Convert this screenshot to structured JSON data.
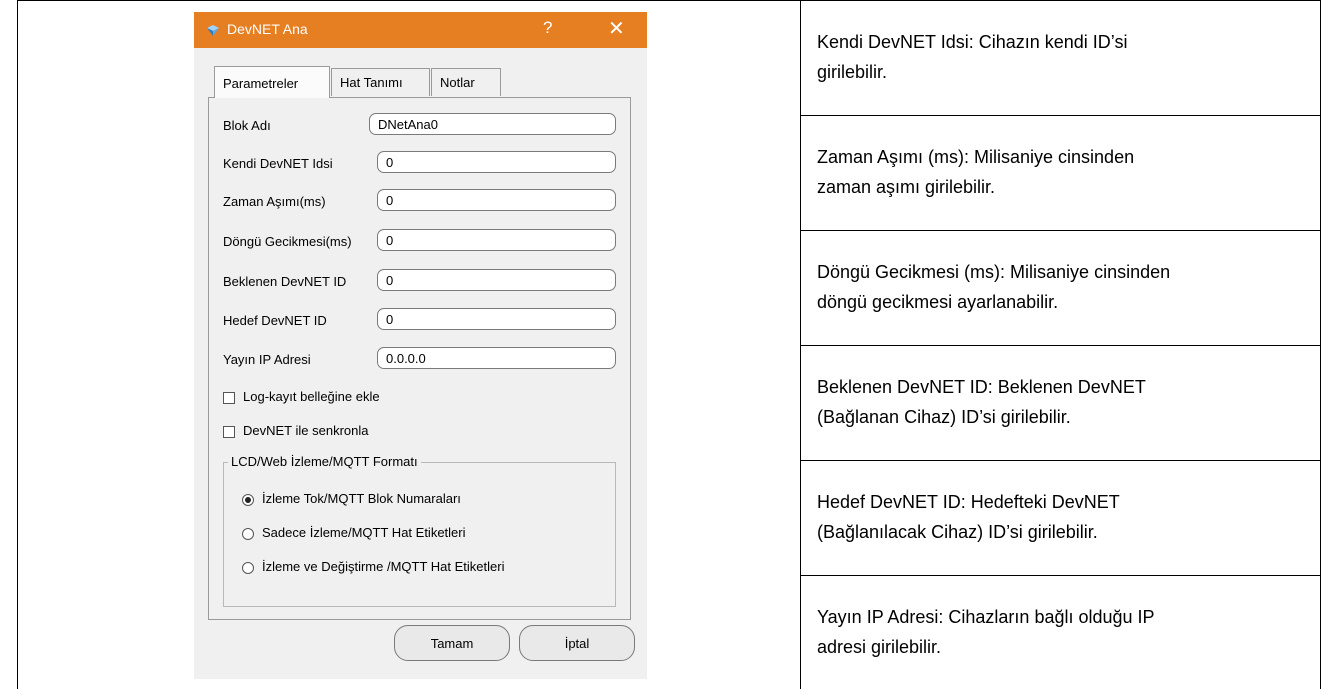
{
  "dialog": {
    "title": "DevNET Ana",
    "help_label": "?",
    "close_label": "✕",
    "tabs": [
      "Parametreler",
      "Hat Tanımı",
      "Notlar"
    ],
    "fields": [
      {
        "label": "Blok Adı",
        "value": "DNetAna0"
      },
      {
        "label": "Kendi DevNET Idsi",
        "value": "0"
      },
      {
        "label": "Zaman Aşımı(ms)",
        "value": "0"
      },
      {
        "label": "Döngü Gecikmesi(ms)",
        "value": "0"
      },
      {
        "label": "Beklenen DevNET ID",
        "value": "0"
      },
      {
        "label": "Hedef DevNET ID",
        "value": "0"
      },
      {
        "label": "Yayın IP Adresi",
        "value": "0.0.0.0"
      }
    ],
    "checkboxes": [
      {
        "label": "Log-kayıt belleğine ekle",
        "checked": false
      },
      {
        "label": "DevNET ile senkronla",
        "checked": false
      }
    ],
    "group": {
      "title": "LCD/Web İzleme/MQTT Formatı",
      "options": [
        {
          "label": "İzleme Tok/MQTT Blok Numaraları",
          "selected": true
        },
        {
          "label": "Sadece İzleme/MQTT Hat Etiketleri",
          "selected": false
        },
        {
          "label": "İzleme ve Değiştirme /MQTT Hat Etiketleri",
          "selected": false
        }
      ]
    },
    "buttons": {
      "ok": "Tamam",
      "cancel": "İptal"
    },
    "accent_color": "#e67e22"
  },
  "descriptions": [
    {
      "line1": "Kendi DevNET Idsi:  Cihazın kendi ID’si",
      "line2": "girilebilir."
    },
    {
      "line1": "Zaman Aşımı (ms):  Milisaniye cinsinden",
      "line2": "zaman aşımı girilebilir."
    },
    {
      "line1": "Döngü Gecikmesi (ms):  Milisaniye cinsinden",
      "line2": "döngü gecikmesi ayarlanabilir."
    },
    {
      "line1": "Beklenen DevNET ID:  Beklenen DevNET",
      "line2": "(Bağlanan Cihaz) ID’si girilebilir."
    },
    {
      "line1": "Hedef DevNET ID:  Hedefteki DevNET",
      "line2": "(Bağlanılacak Cihaz) ID’si girilebilir."
    },
    {
      "line1": "Yayın IP Adresi:  Cihazların bağlı olduğu IP",
      "line2": "adresi girilebilir."
    }
  ]
}
